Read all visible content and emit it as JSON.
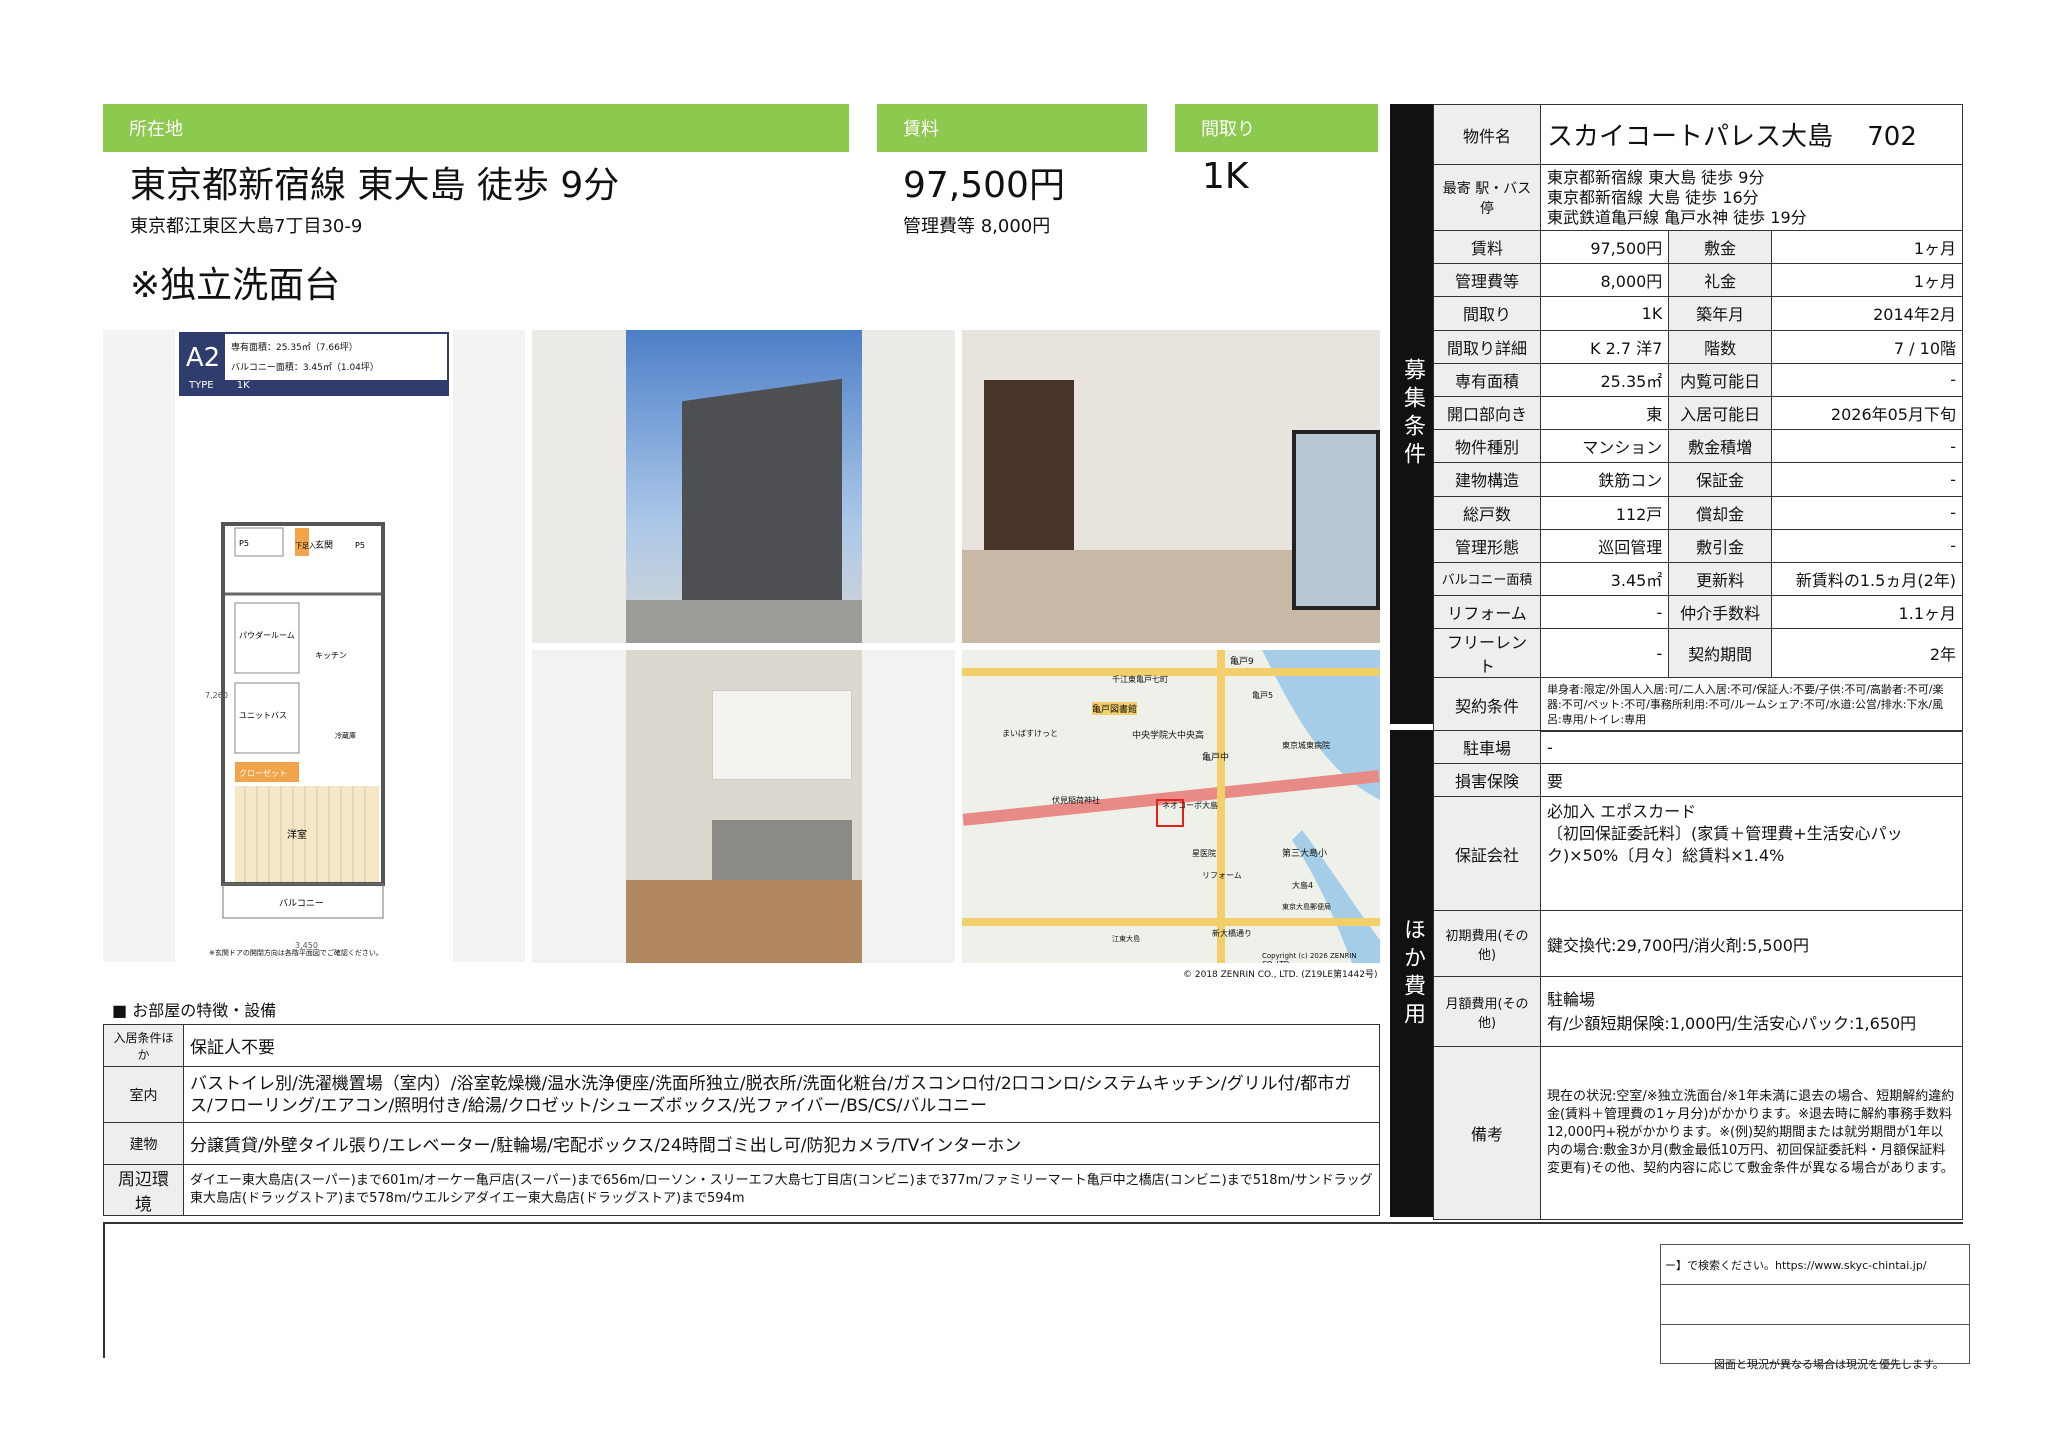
{
  "header": {
    "location_label": "所在地",
    "rent_label": "賃料",
    "layout_label": "間取り"
  },
  "main": {
    "station": "東京都新宿線 東大島 徒歩 9分",
    "address": "東京都江東区大島7丁目30-9",
    "highlight": "※独立洗面台",
    "rent": "97,500円",
    "mgmt": "管理費等 8,000円",
    "layout": "1K"
  },
  "floorplan": {
    "type_code": "A2",
    "area1": "専有面積：25.35㎡（7.66坪）",
    "area2": "バルコニー面積：3.45㎡（1.04坪）",
    "type_label": "TYPE",
    "type_value": "1K",
    "rooms": [
      "P5",
      "下足入",
      "玄関",
      "P5",
      "パウダールーム",
      "ユニットバス",
      "キッチン",
      "冷蔵庫",
      "クローゼット",
      "洋室",
      "バルコニー"
    ],
    "dims": [
      "7,260",
      "3,450"
    ],
    "note": "※玄関ドアの開閉方向は各階平面図でご確認ください。"
  },
  "map": {
    "labels": [
      "千江東亀戸七町",
      "亀戸9",
      "亀戸図書館",
      "まいばすけっと",
      "中央学院大中央高",
      "亀戸中",
      "東京城東病院",
      "伏見稲荷神社",
      "ネオコーポ大島",
      "星医院",
      "第三大島小",
      "リフォーム",
      "大島4",
      "新大橋通り",
      "江東大島",
      "東京大島郵便局",
      "亀戸5"
    ],
    "copyright_inner": "Copyright (c) 2026 ZENRIN CO.,LTD.",
    "copyright": "© 2018 ZENRIN CO., LTD. (Z19LE第1442号)"
  },
  "features": {
    "title": "■ お部屋の特徴・設備",
    "rows": [
      {
        "k": "入居条件ほか",
        "v": "保証人不要"
      },
      {
        "k": "室内",
        "v": "バストイレ別/洗濯機置場（室内）/浴室乾燥機/温水洗浄便座/洗面所独立/脱衣所/洗面化粧台/ガスコンロ付/2口コンロ/システムキッチン/グリル付/都市ガス/フローリング/エアコン/照明付き/給湯/クロゼット/シューズボックス/光ファイバー/BS/CS/バルコニー"
      },
      {
        "k": "建物",
        "v": "分譲賃貸/外壁タイル張り/エレベーター/駐輪場/宅配ボックス/24時間ゴミ出し可/防犯カメラ/TVインターホン"
      },
      {
        "k": "周辺環境",
        "v": "ダイエー東大島店(スーパー)まで601m/オーケー亀戸店(スーパー)まで656m/ローソン・スリーエフ大島七丁目店(コンビニ)まで377m/ファミリーマート亀戸中之橋店(コンビニ)まで518m/サンドラッグ東大島店(ドラッグストア)まで578m/ウエルシアダイエー東大島店(ドラッグストア)まで594m"
      }
    ]
  },
  "side1": {
    "label": "募集条件",
    "name_key": "物件名",
    "name": "スカイコートパレス大島　 702",
    "station_key": "最寄 駅・バス停",
    "stations": [
      "東京都新宿線 東大島 徒歩 9分",
      "東京都新宿線 大島 徒歩 16分",
      "東武鉄道亀戸線 亀戸水神 徒歩 19分"
    ],
    "rows": [
      [
        "賃料",
        "97,500円",
        "敷金",
        "1ヶ月"
      ],
      [
        "管理費等",
        "8,000円",
        "礼金",
        "1ヶ月"
      ],
      [
        "間取り",
        "1K",
        "築年月",
        "2014年2月"
      ],
      [
        "間取り詳細",
        "K 2.7 洋7",
        "階数",
        "7 / 10階"
      ],
      [
        "専有面積",
        "25.35㎡",
        "内覧可能日",
        "-"
      ],
      [
        "開口部向き",
        "東",
        "入居可能日",
        "2026年05月下旬"
      ],
      [
        "物件種別",
        "マンション",
        "敷金積増",
        "-"
      ],
      [
        "建物構造",
        "鉄筋コン",
        "保証金",
        "-"
      ],
      [
        "総戸数",
        "112戸",
        "償却金",
        "-"
      ],
      [
        "管理形態",
        "巡回管理",
        "敷引金",
        "-"
      ],
      [
        "バルコニー面積",
        "3.45㎡",
        "更新料",
        "新賃料の1.5ヵ月(2年)"
      ],
      [
        "リフォーム",
        "-",
        "仲介手数料",
        "1.1ヶ月"
      ],
      [
        "フリーレント",
        "-",
        "契約期間",
        "2年"
      ]
    ],
    "contract_key": "契約条件",
    "contract": "単身者:限定/外国人入居:可/二人入居:不可/保証人:不要/子供:不可/高齢者:不可/楽器:不可/ペット:不可/事務所利用:不可/ルームシェア:不可/水道:公営/排水:下水/風呂:専用/トイレ:専用"
  },
  "side2": {
    "label": "ほか費用",
    "rows": [
      {
        "k": "駐車場",
        "v": "-"
      },
      {
        "k": "損害保険",
        "v": "要"
      },
      {
        "k": "保証会社",
        "v": "必加入 エポスカード\n〔初回保証委託料〕(家賃＋管理費+生活安心パック)×50%〔月々〕総賃料×1.4%"
      },
      {
        "k": "初期費用(その他)",
        "v": "鍵交換代:29,700円/消火剤:5,500円"
      },
      {
        "k": "月額費用(その他)",
        "v": "駐輪場\n有/少額短期保険:1,000円/生活安心パック:1,650円"
      },
      {
        "k": "備考",
        "v": "現在の状況:空室/※独立洗面台/※1年未満に退去の場合、短期解約違約金(賃料＋管理費の1ヶ月分)がかかります。※退去時に解約事務手数料12,000円+税がかかります。※(例)契約期間または就労期間が1年以内の場合:敷金3か月(敷金最低10万円、初回保証委託料・月額保証料変更有)その他、契約内容に応じて敷金条件が異なる場合があります。"
      }
    ]
  },
  "footer": {
    "search": "ー】で検索ください。https://www.skyc-chintai.jp/",
    "disclaimer": "図面と現況が異なる場合は現況を優先します。"
  }
}
